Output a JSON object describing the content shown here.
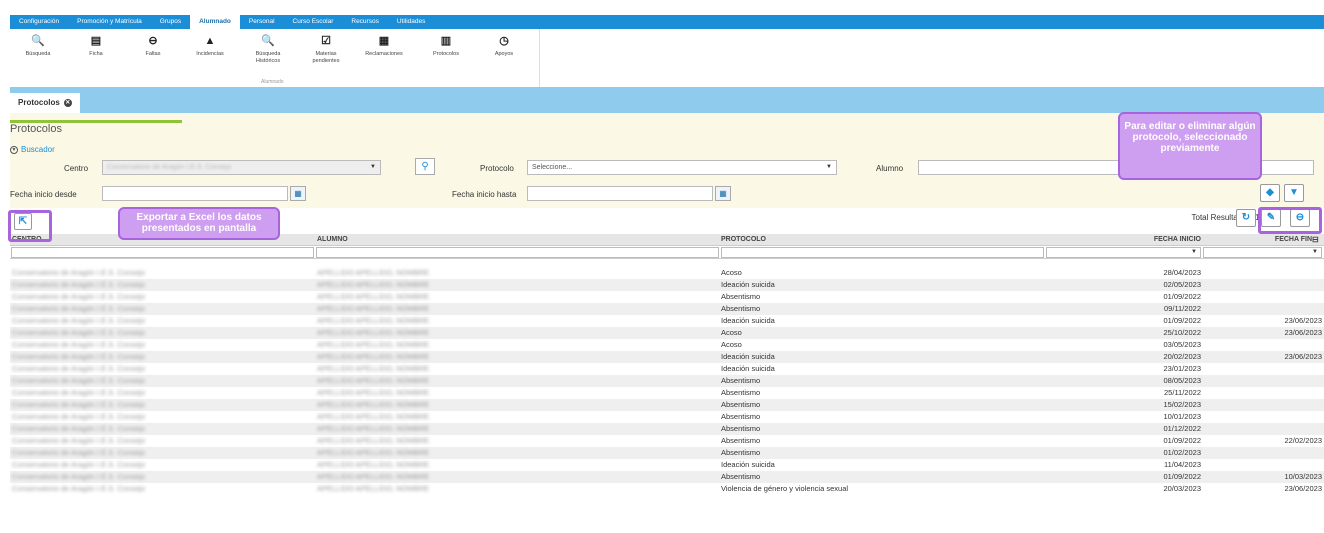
{
  "menu": [
    "Configuración",
    "Promoción y Matrícula",
    "Grupos",
    "Alumnado",
    "Personal",
    "Curso Escolar",
    "Recursos",
    "Utilidades"
  ],
  "menu_active": "Alumnado",
  "ribbon": [
    {
      "icon": "search-icon",
      "glyph": "🔍",
      "label": "Búsqueda"
    },
    {
      "icon": "id-card-icon",
      "glyph": "▤",
      "label": "Ficha"
    },
    {
      "icon": "minus-circle-icon",
      "glyph": "⊖",
      "label": "Faltas"
    },
    {
      "icon": "warning-icon",
      "glyph": "▲",
      "label": "Incidencias"
    },
    {
      "icon": "search-history-icon",
      "glyph": "🔍",
      "label": "Búsqueda Históricos"
    },
    {
      "icon": "checkbox-icon",
      "glyph": "☑",
      "label": "Materias pendientes"
    },
    {
      "icon": "document-icon",
      "glyph": "▦",
      "label": "Reclamaciones"
    },
    {
      "icon": "protocol-icon",
      "glyph": "▥",
      "label": "Protocolos"
    },
    {
      "icon": "support-icon",
      "glyph": "◷",
      "label": "Apoyos"
    }
  ],
  "ribbon_group": "Alumnado",
  "tab": "Protocolos",
  "page_title": "Protocolos",
  "buscador": "Buscador",
  "form": {
    "centro_label": "Centro",
    "centro_value": "Conservatorio de Aragón I.E.S. Consejo",
    "protocolo_label": "Protocolo",
    "protocolo_placeholder": "Seleccione...",
    "alumno_label": "Alumno",
    "fecha_desde_label": "Fecha inicio desde",
    "fecha_hasta_label": "Fecha inicio hasta"
  },
  "total": "Total Resultados: 19",
  "columns": [
    "CENTRO",
    "ALUMNO",
    "PROTOCOLO",
    "FECHA INICIO",
    "FECHA FIN"
  ],
  "rows": [
    {
      "centro": "Conservatorio de Aragón I.E.S. Consejo",
      "alumno": "APELLIDO APELLIDO, NOMBRE",
      "protocolo": "Acoso",
      "inicio": "28/04/2023",
      "fin": ""
    },
    {
      "centro": "Conservatorio de Aragón I.E.S. Consejo",
      "alumno": "APELLIDO APELLIDO, NOMBRE",
      "protocolo": "Ideación suicida",
      "inicio": "02/05/2023",
      "fin": ""
    },
    {
      "centro": "Conservatorio de Aragón I.E.S. Consejo",
      "alumno": "APELLIDO APELLIDO, NOMBRE",
      "protocolo": "Absentismo",
      "inicio": "01/09/2022",
      "fin": ""
    },
    {
      "centro": "Conservatorio de Aragón I.E.S. Consejo",
      "alumno": "APELLIDO APELLIDO, NOMBRE",
      "protocolo": "Absentismo",
      "inicio": "09/11/2022",
      "fin": ""
    },
    {
      "centro": "Conservatorio de Aragón I.E.S. Consejo",
      "alumno": "APELLIDO APELLIDO, NOMBRE",
      "protocolo": "Ideación suicida",
      "inicio": "01/09/2022",
      "fin": "23/06/2023"
    },
    {
      "centro": "Conservatorio de Aragón I.E.S. Consejo",
      "alumno": "APELLIDO APELLIDO, NOMBRE",
      "protocolo": "Acoso",
      "inicio": "25/10/2022",
      "fin": "23/06/2023"
    },
    {
      "centro": "Conservatorio de Aragón I.E.S. Consejo",
      "alumno": "APELLIDO APELLIDO, NOMBRE",
      "protocolo": "Acoso",
      "inicio": "03/05/2023",
      "fin": ""
    },
    {
      "centro": "Conservatorio de Aragón I.E.S. Consejo",
      "alumno": "APELLIDO APELLIDO, NOMBRE",
      "protocolo": "Ideación suicida",
      "inicio": "20/02/2023",
      "fin": "23/06/2023"
    },
    {
      "centro": "Conservatorio de Aragón I.E.S. Consejo",
      "alumno": "APELLIDO APELLIDO, NOMBRE",
      "protocolo": "Ideación suicida",
      "inicio": "23/01/2023",
      "fin": ""
    },
    {
      "centro": "Conservatorio de Aragón I.E.S. Consejo",
      "alumno": "APELLIDO APELLIDO, NOMBRE",
      "protocolo": "Absentismo",
      "inicio": "08/05/2023",
      "fin": ""
    },
    {
      "centro": "Conservatorio de Aragón I.E.S. Consejo",
      "alumno": "APELLIDO APELLIDO, NOMBRE",
      "protocolo": "Absentismo",
      "inicio": "25/11/2022",
      "fin": ""
    },
    {
      "centro": "Conservatorio de Aragón I.E.S. Consejo",
      "alumno": "APELLIDO APELLIDO, NOMBRE",
      "protocolo": "Absentismo",
      "inicio": "15/02/2023",
      "fin": ""
    },
    {
      "centro": "Conservatorio de Aragón I.E.S. Consejo",
      "alumno": "APELLIDO APELLIDO, NOMBRE",
      "protocolo": "Absentismo",
      "inicio": "10/01/2023",
      "fin": ""
    },
    {
      "centro": "Conservatorio de Aragón I.E.S. Consejo",
      "alumno": "APELLIDO APELLIDO, NOMBRE",
      "protocolo": "Absentismo",
      "inicio": "01/12/2022",
      "fin": ""
    },
    {
      "centro": "Conservatorio de Aragón I.E.S. Consejo",
      "alumno": "APELLIDO APELLIDO, NOMBRE",
      "protocolo": "Absentismo",
      "inicio": "01/09/2022",
      "fin": "22/02/2023"
    },
    {
      "centro": "Conservatorio de Aragón I.E.S. Consejo",
      "alumno": "APELLIDO APELLIDO, NOMBRE",
      "protocolo": "Absentismo",
      "inicio": "01/02/2023",
      "fin": ""
    },
    {
      "centro": "Conservatorio de Aragón I.E.S. Consejo",
      "alumno": "APELLIDO APELLIDO, NOMBRE",
      "protocolo": "Ideación suicida",
      "inicio": "11/04/2023",
      "fin": ""
    },
    {
      "centro": "Conservatorio de Aragón I.E.S. Consejo",
      "alumno": "APELLIDO APELLIDO, NOMBRE",
      "protocolo": "Absentismo",
      "inicio": "01/09/2022",
      "fin": "10/03/2023"
    },
    {
      "centro": "Conservatorio de Aragón I.E.S. Consejo",
      "alumno": "APELLIDO APELLIDO, NOMBRE",
      "protocolo": "Violencia de género y violencia sexual",
      "inicio": "20/03/2023",
      "fin": "23/06/2023"
    }
  ],
  "callout_edit": "Para editar o eliminar algún protocolo, seleccionado previamente",
  "callout_export": "Exportar a Excel los datos presentados en pantalla"
}
